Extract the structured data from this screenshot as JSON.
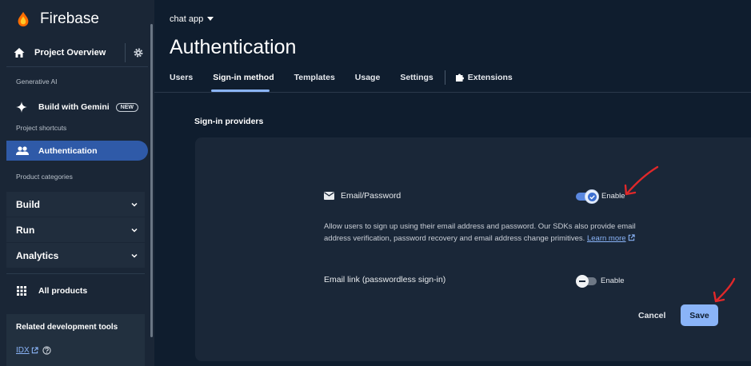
{
  "sidebar": {
    "brand": "Firebase",
    "project_overview": "Project Overview",
    "gen_ai_label": "Generative AI",
    "build_with_gemini": "Build with Gemini",
    "new_badge": "NEW",
    "shortcuts_label": "Project shortcuts",
    "authentication": "Authentication",
    "categories_label": "Product categories",
    "build": "Build",
    "run": "Run",
    "analytics": "Analytics",
    "all_products": "All products",
    "related_tools": "Related development tools",
    "idx": "IDX"
  },
  "header": {
    "project_name": "chat app",
    "title": "Authentication"
  },
  "tabs": [
    {
      "label": "Users"
    },
    {
      "label": "Sign-in method"
    },
    {
      "label": "Templates"
    },
    {
      "label": "Usage"
    },
    {
      "label": "Settings"
    },
    {
      "label": "Extensions"
    }
  ],
  "providers": {
    "section_label": "Sign-in providers",
    "email_password": {
      "label": "Email/Password",
      "toggle_label": "Enable",
      "enabled": true
    },
    "description": "Allow users to sign up using their email address and password. Our SDKs also provide email address verification, password recovery and email address change primitives.",
    "learn_more": "Learn more",
    "email_link": {
      "label": "Email link (passwordless sign-in)",
      "toggle_label": "Enable",
      "enabled": false
    },
    "cancel": "Cancel",
    "save": "Save"
  },
  "colors": {
    "accent": "#8ab4f8",
    "active_nav": "#2f5aa8",
    "annotation_arrow": "#e0282a"
  }
}
